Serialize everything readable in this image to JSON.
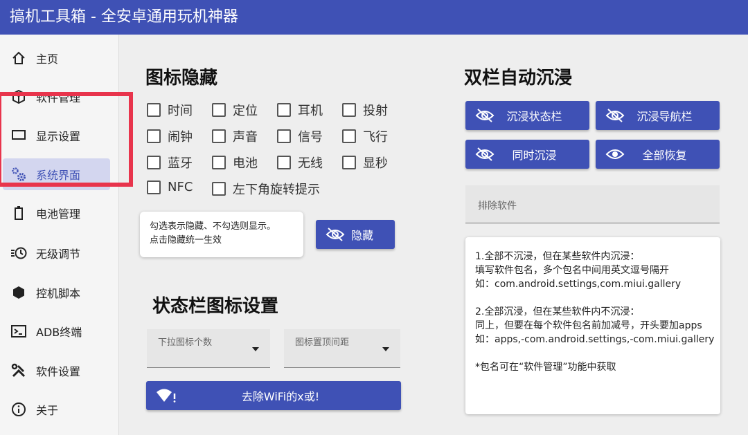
{
  "app": {
    "title": "搞机工具箱 - 全安卓通用玩机神器"
  },
  "sidebar": {
    "items": [
      {
        "label": "主页",
        "icon": "home-icon"
      },
      {
        "label": "软件管理",
        "icon": "cube-icon"
      },
      {
        "label": "显示设置",
        "icon": "display-icon"
      },
      {
        "label": "系统界面",
        "icon": "gears-icon"
      },
      {
        "label": "电池管理",
        "icon": "battery-icon"
      },
      {
        "label": "无级调节",
        "icon": "clock-icon"
      },
      {
        "label": "控机脚本",
        "icon": "hexagon-icon"
      },
      {
        "label": "ADB终端",
        "icon": "terminal-icon"
      },
      {
        "label": "软件设置",
        "icon": "tools-icon"
      },
      {
        "label": "关于",
        "icon": "info-icon"
      }
    ],
    "active_index": 3
  },
  "icon_hide": {
    "title": "图标隐藏",
    "checkboxes": [
      "时间",
      "定位",
      "耳机",
      "投射",
      "闹钟",
      "声音",
      "信号",
      "飞行",
      "蓝牙",
      "电池",
      "无线",
      "显秒",
      "NFC",
      "左下角旋转提示"
    ],
    "hint_line1": "勾选表示隐藏、不勾选则显示。",
    "hint_line2": "点击隐藏统一生效",
    "hide_button": "隐藏"
  },
  "statusbar_settings": {
    "title": "状态栏图标设置",
    "pulldown_count_placeholder": "下拉图标个数",
    "top_spacing_placeholder": "图标置顶间距",
    "wifi_button": "去除WiFi的x或!"
  },
  "immersive": {
    "title": "双栏自动沉浸",
    "buttons": [
      "沉浸状态栏",
      "沉浸导航栏",
      "同时沉浸",
      "全部恢复"
    ],
    "exclude_placeholder": "排除软件",
    "notes": [
      "1.全部不沉浸，但在某些软件内沉浸：",
      "填写软件包名，多个包名中间用英文逗号隔开",
      "如：com.android.settings,com.miui.gallery",
      "",
      "2.全部沉浸，但在某些软件内不沉浸：",
      "同上，但要在每个软件包名前加减号，开头要加apps",
      "如：apps,-com.android.settings,-com.miui.gallery",
      "",
      "*包名可在“软件管理”功能中获取"
    ]
  },
  "colors": {
    "primary": "#3f51b5",
    "highlight": "#e8344c",
    "active_bg": "#d3d6ef"
  }
}
